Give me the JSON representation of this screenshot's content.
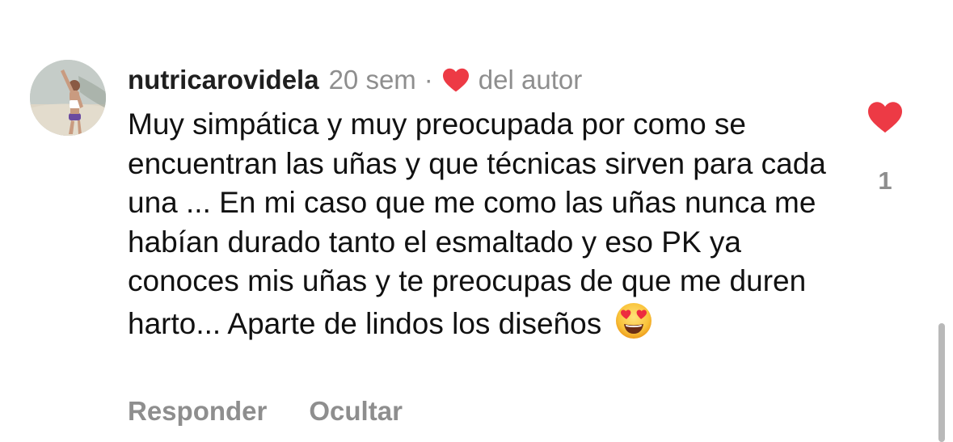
{
  "comment": {
    "username": "nutricarovidela",
    "time": "20 sem",
    "separator": "·",
    "author_like_label": "del autor",
    "text": "Muy simpática y muy preocupada por como se encuentran las uñas y que técnicas sirven para cada una ... En mi caso que me como las uñas nunca me habían durado tanto el esmaltado y eso PK ya conoces mis uñas y te preocupas de que me duren harto... Aparte de lindos los diseños",
    "emoji": "smiling-face-with-heart-eyes",
    "like_count": "1",
    "avatar": "profile-photo"
  },
  "actions": {
    "reply_label": "Responder",
    "hide_label": "Ocultar"
  },
  "colors": {
    "heart": "#ed3a45",
    "secondary_text": "#8e8e8e",
    "primary_text": "#111111",
    "scrollbar": "#b9b9b9"
  }
}
